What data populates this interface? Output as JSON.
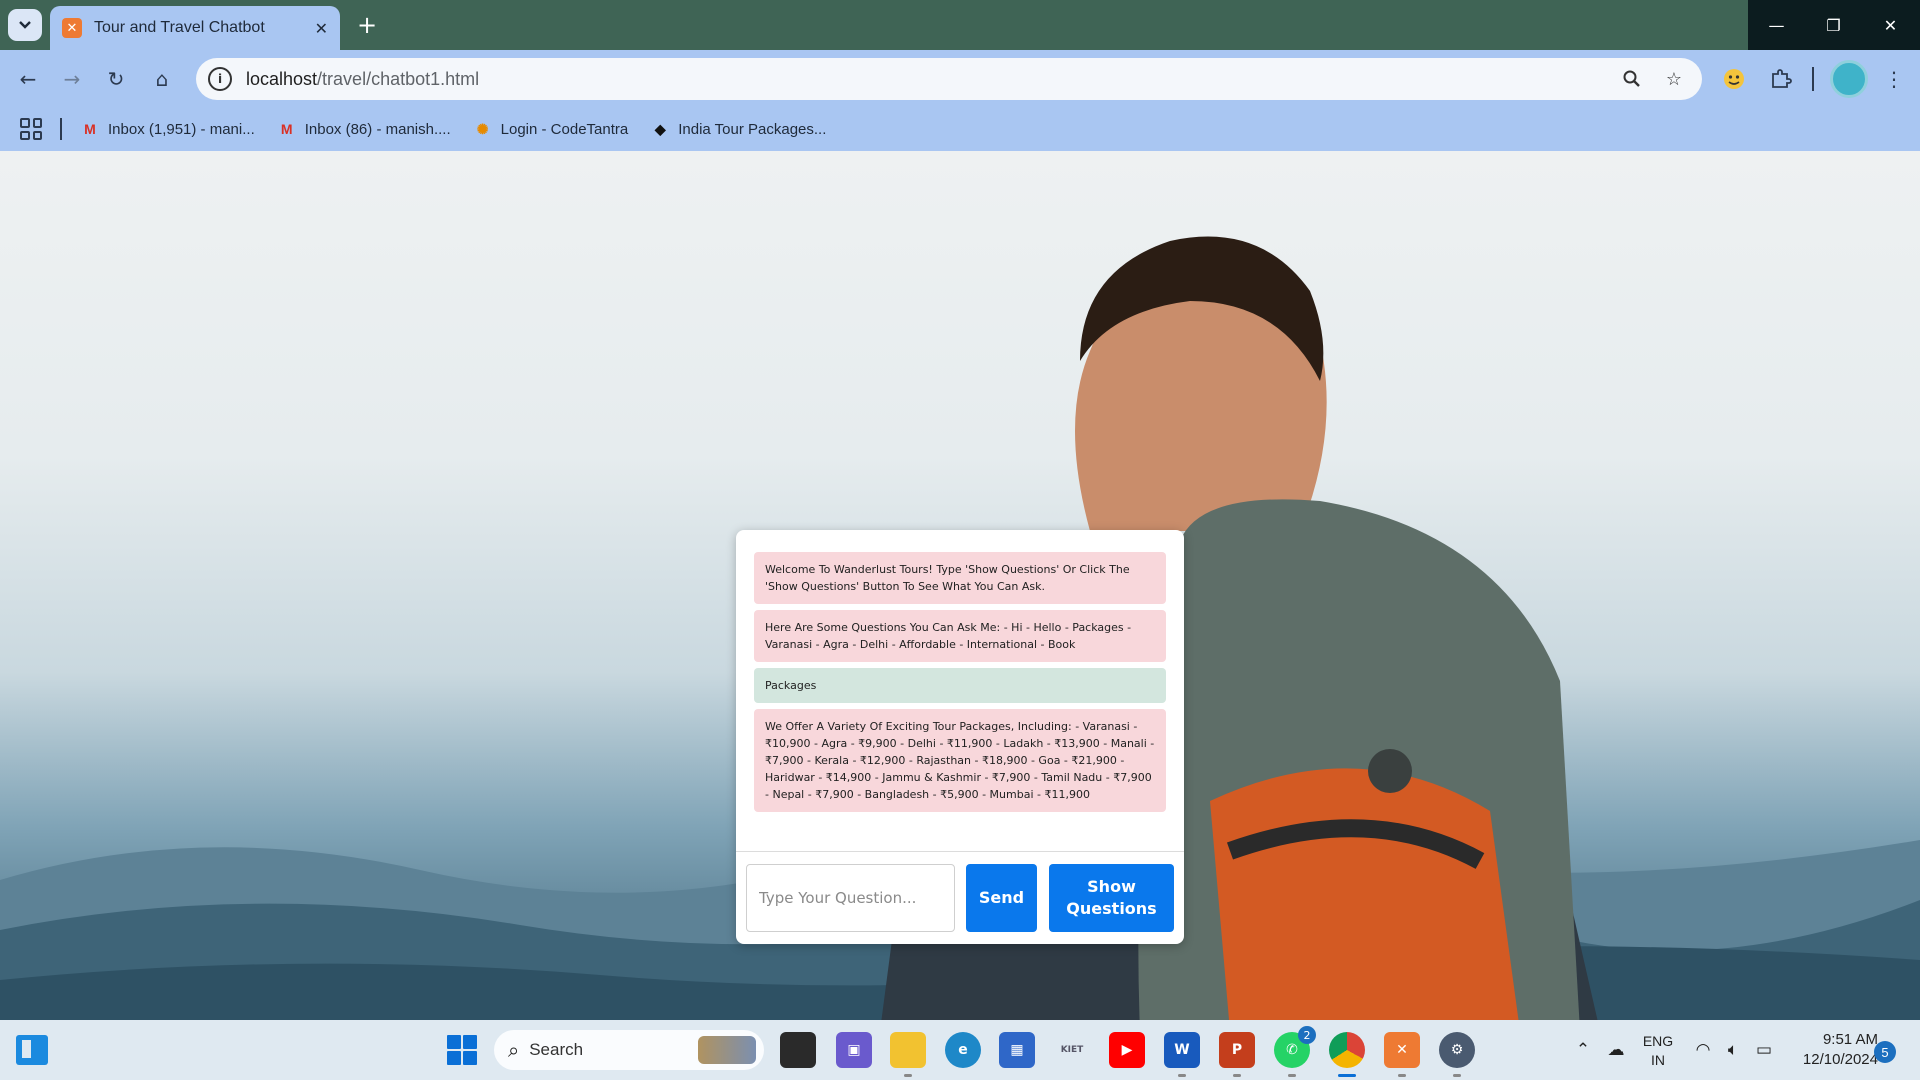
{
  "browser": {
    "tab_title": "Tour and Travel Chatbot",
    "url_host": "localhost",
    "url_path": "/travel/chatbot1.html",
    "bookmarks": [
      {
        "label": "Inbox (1,951) - mani...",
        "icon": "gmail-icon"
      },
      {
        "label": "Inbox (86) - manish....",
        "icon": "gmail-icon"
      },
      {
        "label": "Login - CodeTantra",
        "icon": "codetantra-icon"
      },
      {
        "label": "India Tour Packages...",
        "icon": "india-map-icon"
      }
    ]
  },
  "chat": {
    "messages": [
      {
        "role": "bot",
        "text": "Welcome To Wanderlust Tours! Type 'Show Questions' Or Click The 'Show Questions' Button To See What You Can Ask."
      },
      {
        "role": "bot",
        "text": "Here Are Some Questions You Can Ask Me: - Hi - Hello - Packages - Varanasi - Agra - Delhi - Affordable - International - Book"
      },
      {
        "role": "user",
        "text": "Packages"
      },
      {
        "role": "bot",
        "text": "We Offer A Variety Of Exciting Tour Packages, Including: - Varanasi - ₹10,900 - Agra - ₹9,900 - Delhi - ₹11,900 - Ladakh - ₹13,900 - Manali - ₹7,900 - Kerala - ₹12,900 - Rajasthan - ₹18,900 - Goa - ₹21,900 - Haridwar - ₹14,900 - Jammu & Kashmir - ₹7,900 - Tamil Nadu - ₹7,900 - Nepal - ₹7,900 - Bangladesh - ₹5,900 - Mumbai - ₹11,900"
      }
    ],
    "input_placeholder": "Type Your Question...",
    "send_label": "Send",
    "show_questions_label": "Show Questions",
    "colors": {
      "bot_bubble": "#f8d7db",
      "user_bubble": "#d3e6de",
      "button": "#0a78ec"
    }
  },
  "taskbar": {
    "search_label": "Search",
    "whatsapp_badge": "2",
    "lang_top": "ENG",
    "lang_bottom": "IN",
    "time": "9:51 AM",
    "date": "12/10/2024",
    "notifications": "5"
  }
}
